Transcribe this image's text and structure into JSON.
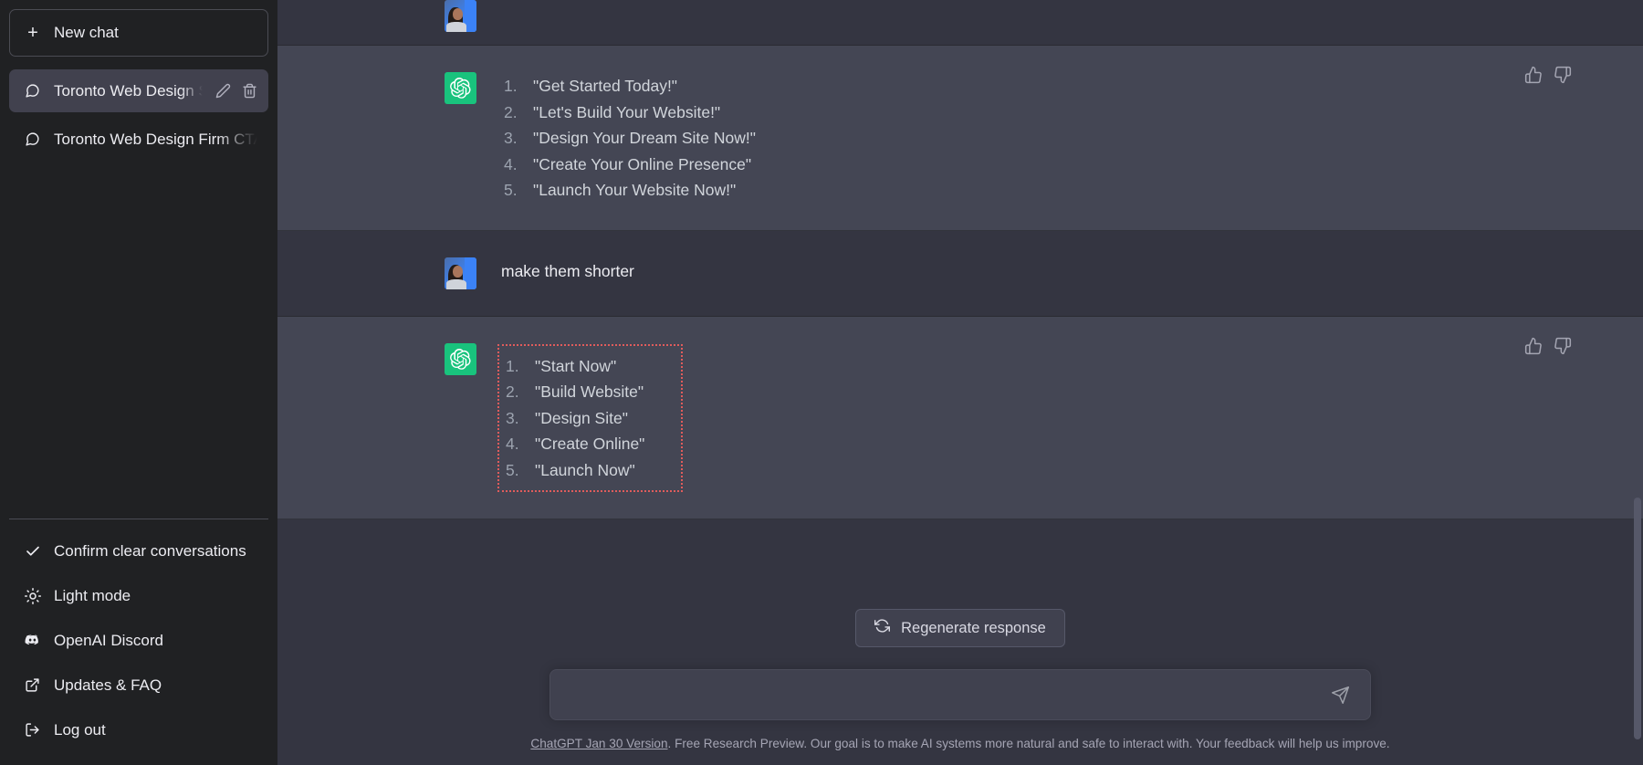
{
  "sidebar": {
    "new_chat_label": "New chat",
    "new_chat_icon": "plus-icon",
    "conversations": [
      {
        "title": "Toronto Web Design Sl",
        "active": true,
        "icon": "chat-bubble-icon",
        "edit_icon": "pencil-icon",
        "delete_icon": "trash-icon"
      },
      {
        "title": "Toronto Web Design Firm CTA",
        "active": false,
        "icon": "chat-bubble-icon"
      }
    ],
    "menu": [
      {
        "label": "Confirm clear conversations",
        "icon": "check-icon"
      },
      {
        "label": "Light mode",
        "icon": "sun-icon"
      },
      {
        "label": "OpenAI Discord",
        "icon": "discord-icon"
      },
      {
        "label": "Updates & FAQ",
        "icon": "external-link-icon"
      },
      {
        "label": "Log out",
        "icon": "logout-icon"
      }
    ]
  },
  "thread": {
    "messages": [
      {
        "role": "user",
        "partial": true,
        "text": ""
      },
      {
        "role": "assistant",
        "items": [
          "\"Get Started Today!\"",
          "\"Let's Build Your Website!\"",
          "\"Design Your Dream Site Now!\"",
          "\"Create Your Online Presence\"",
          "\"Launch Your Website Now!\""
        ],
        "thumbs_up_icon": "thumbs-up-icon",
        "thumbs_down_icon": "thumbs-down-icon"
      },
      {
        "role": "user",
        "text": "make them shorter"
      },
      {
        "role": "assistant",
        "highlighted": true,
        "items": [
          "\"Start Now\"",
          "\"Build Website\"",
          "\"Design Site\"",
          "\"Create Online\"",
          "\"Launch Now\""
        ],
        "thumbs_up_icon": "thumbs-up-icon",
        "thumbs_down_icon": "thumbs-down-icon"
      }
    ]
  },
  "composer": {
    "regenerate_label": "Regenerate response",
    "regenerate_icon": "refresh-icon",
    "input_value": "",
    "input_placeholder": "",
    "send_icon": "send-icon"
  },
  "footer": {
    "link_text": "ChatGPT Jan 30 Version",
    "rest_text": ". Free Research Preview. Our goal is to make AI systems more natural and safe to interact with. Your feedback will help us improve."
  },
  "colors": {
    "sidebar_bg": "#202123",
    "user_row_bg": "#343541",
    "assistant_row_bg": "#444654",
    "accent_green": "#19c37d",
    "highlight_red": "#e05c5c",
    "composer_bg": "#40414f"
  }
}
